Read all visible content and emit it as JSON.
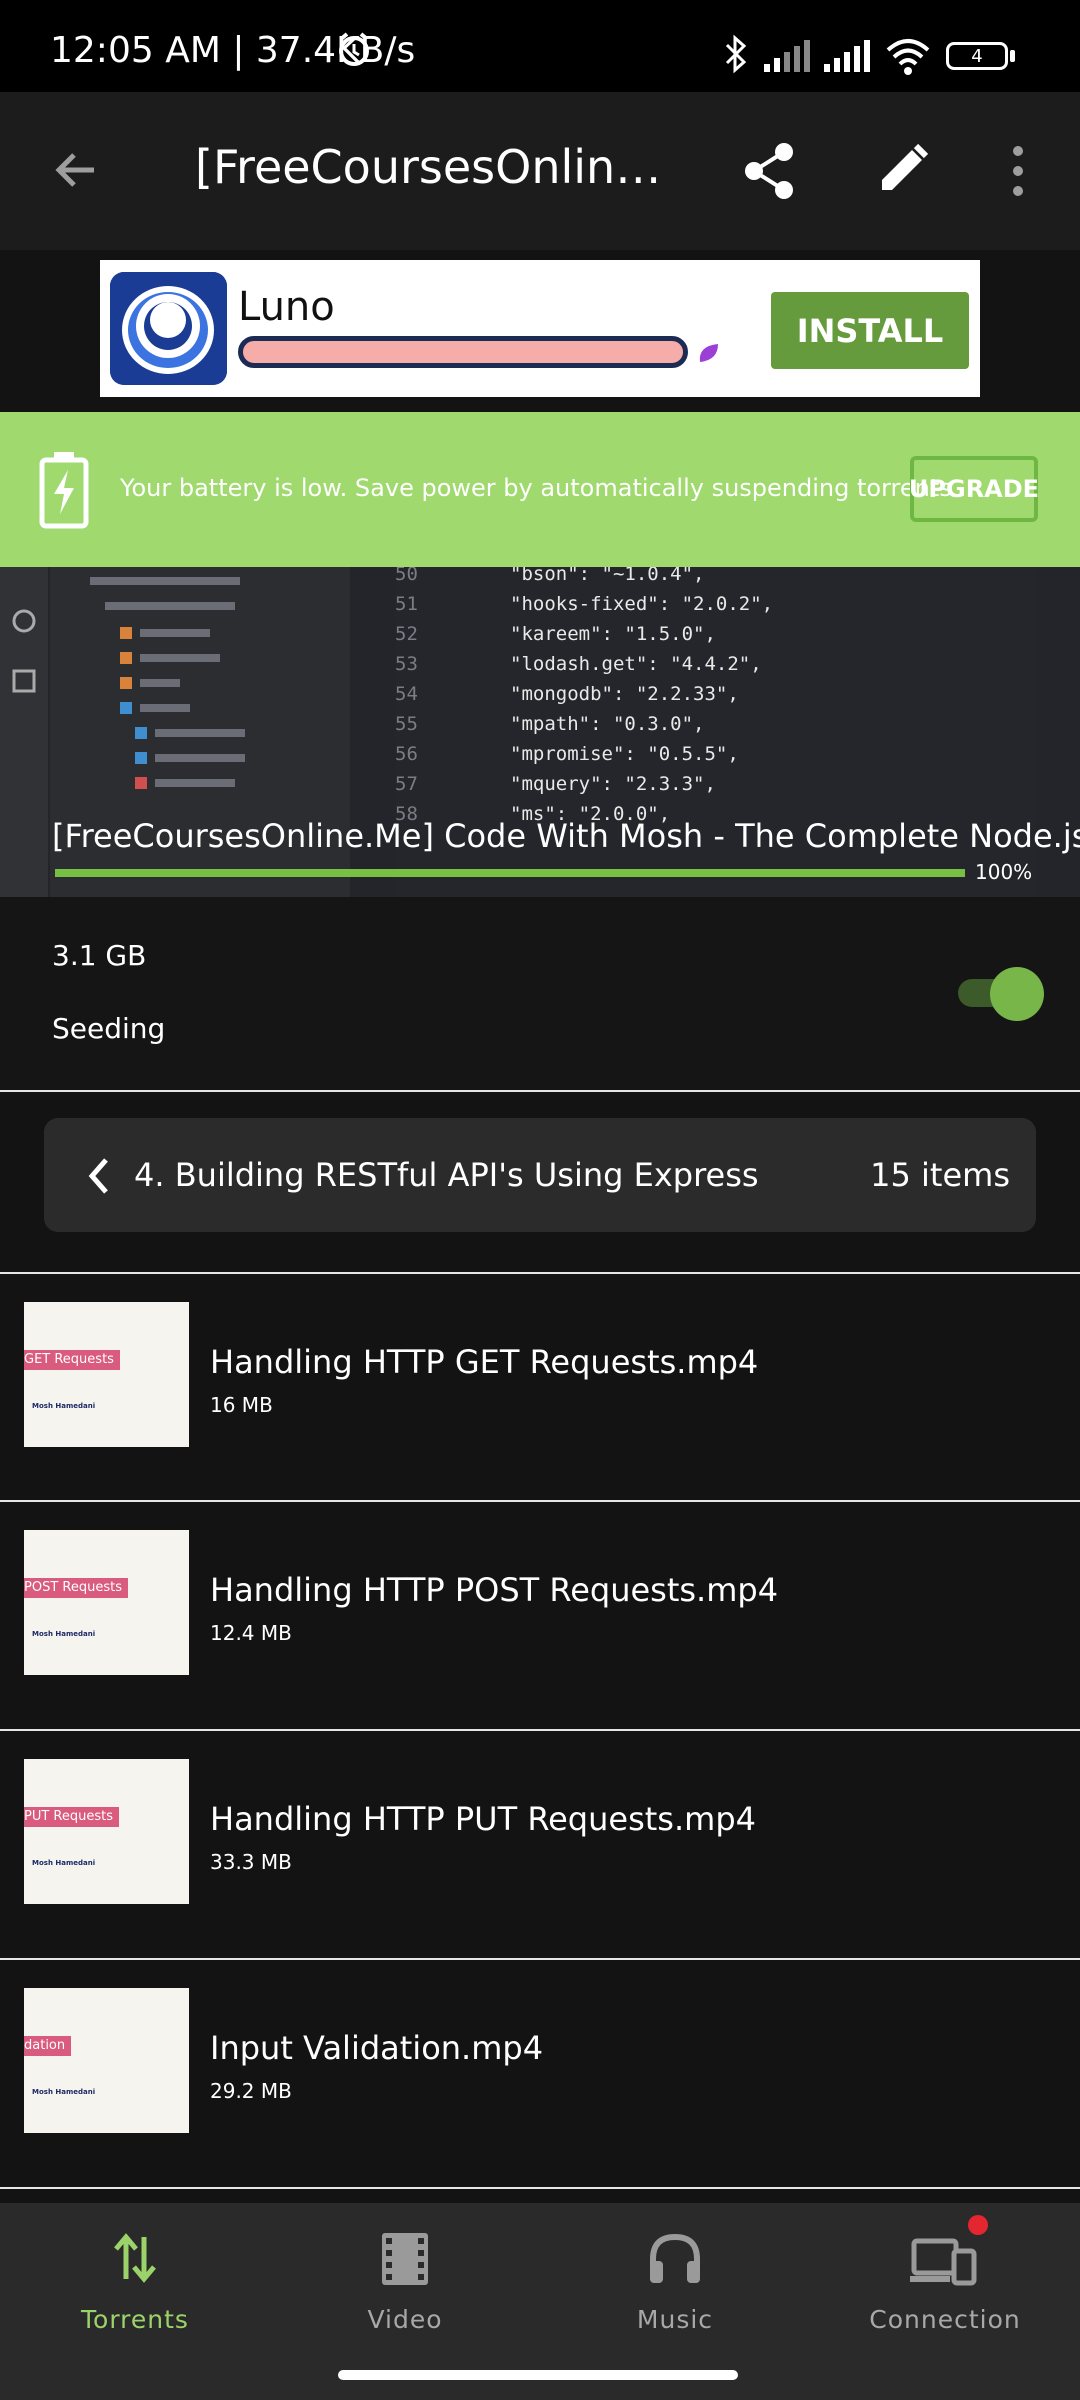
{
  "status_bar": {
    "time_speed": "12:05 AM | 37.4KB/s",
    "battery_level": "4"
  },
  "app_bar": {
    "title": "[FreeCoursesOnline...."
  },
  "ad": {
    "app_name": "Luno",
    "install_label": "INSTALL"
  },
  "battery_banner": {
    "message": "Your battery is low. Save power by automatically suspending torrents",
    "upgrade_label": "UPGRADE"
  },
  "torrent": {
    "name": "[FreeCoursesOnline.Me] Code With Mosh - The Complete Node.js",
    "progress_percent": 100,
    "progress_label": "100%",
    "size": "3.1 GB",
    "status": "Seeding",
    "seeding_enabled": true
  },
  "hero_code": {
    "lines": [
      {
        "num": "50",
        "text": "\"bson\": \"~1.0.4\","
      },
      {
        "num": "51",
        "text": "\"hooks-fixed\": \"2.0.2\","
      },
      {
        "num": "52",
        "text": "\"kareem\": \"1.5.0\","
      },
      {
        "num": "53",
        "text": "\"lodash.get\": \"4.4.2\","
      },
      {
        "num": "54",
        "text": "\"mongodb\": \"2.2.33\","
      },
      {
        "num": "55",
        "text": "\"mpath\": \"0.3.0\","
      },
      {
        "num": "56",
        "text": "\"mpromise\": \"0.5.5\","
      },
      {
        "num": "57",
        "text": "\"mquery\": \"2.3.3\","
      },
      {
        "num": "58",
        "text": "\"ms\": \"2.0.0\","
      }
    ]
  },
  "folder": {
    "name": "4. Building RESTful API's Using Express",
    "count": "15 items"
  },
  "files": [
    {
      "name": "Handling HTTP GET Requests.mp4",
      "size": "16 MB",
      "thumb_tag": "GET Requests"
    },
    {
      "name": "Handling HTTP POST Requests.mp4",
      "size": "12.4 MB",
      "thumb_tag": "POST Requests"
    },
    {
      "name": "Handling HTTP PUT Requests.mp4",
      "size": "33.3 MB",
      "thumb_tag": "PUT Requests"
    },
    {
      "name": "Input Validation.mp4",
      "size": "29.2 MB",
      "thumb_tag": "dation"
    }
  ],
  "thumb_author": "Mosh Hamedani",
  "nav": {
    "items": [
      {
        "label": "Torrents",
        "icon": "transfer-arrows-icon"
      },
      {
        "label": "Video",
        "icon": "film-icon"
      },
      {
        "label": "Music",
        "icon": "headphones-icon"
      },
      {
        "label": "Connection",
        "icon": "devices-icon"
      }
    ]
  },
  "colors": {
    "accent_green": "#9bd36a",
    "banner_green": "#a0d96e",
    "notification_dot": "#e3262f"
  }
}
